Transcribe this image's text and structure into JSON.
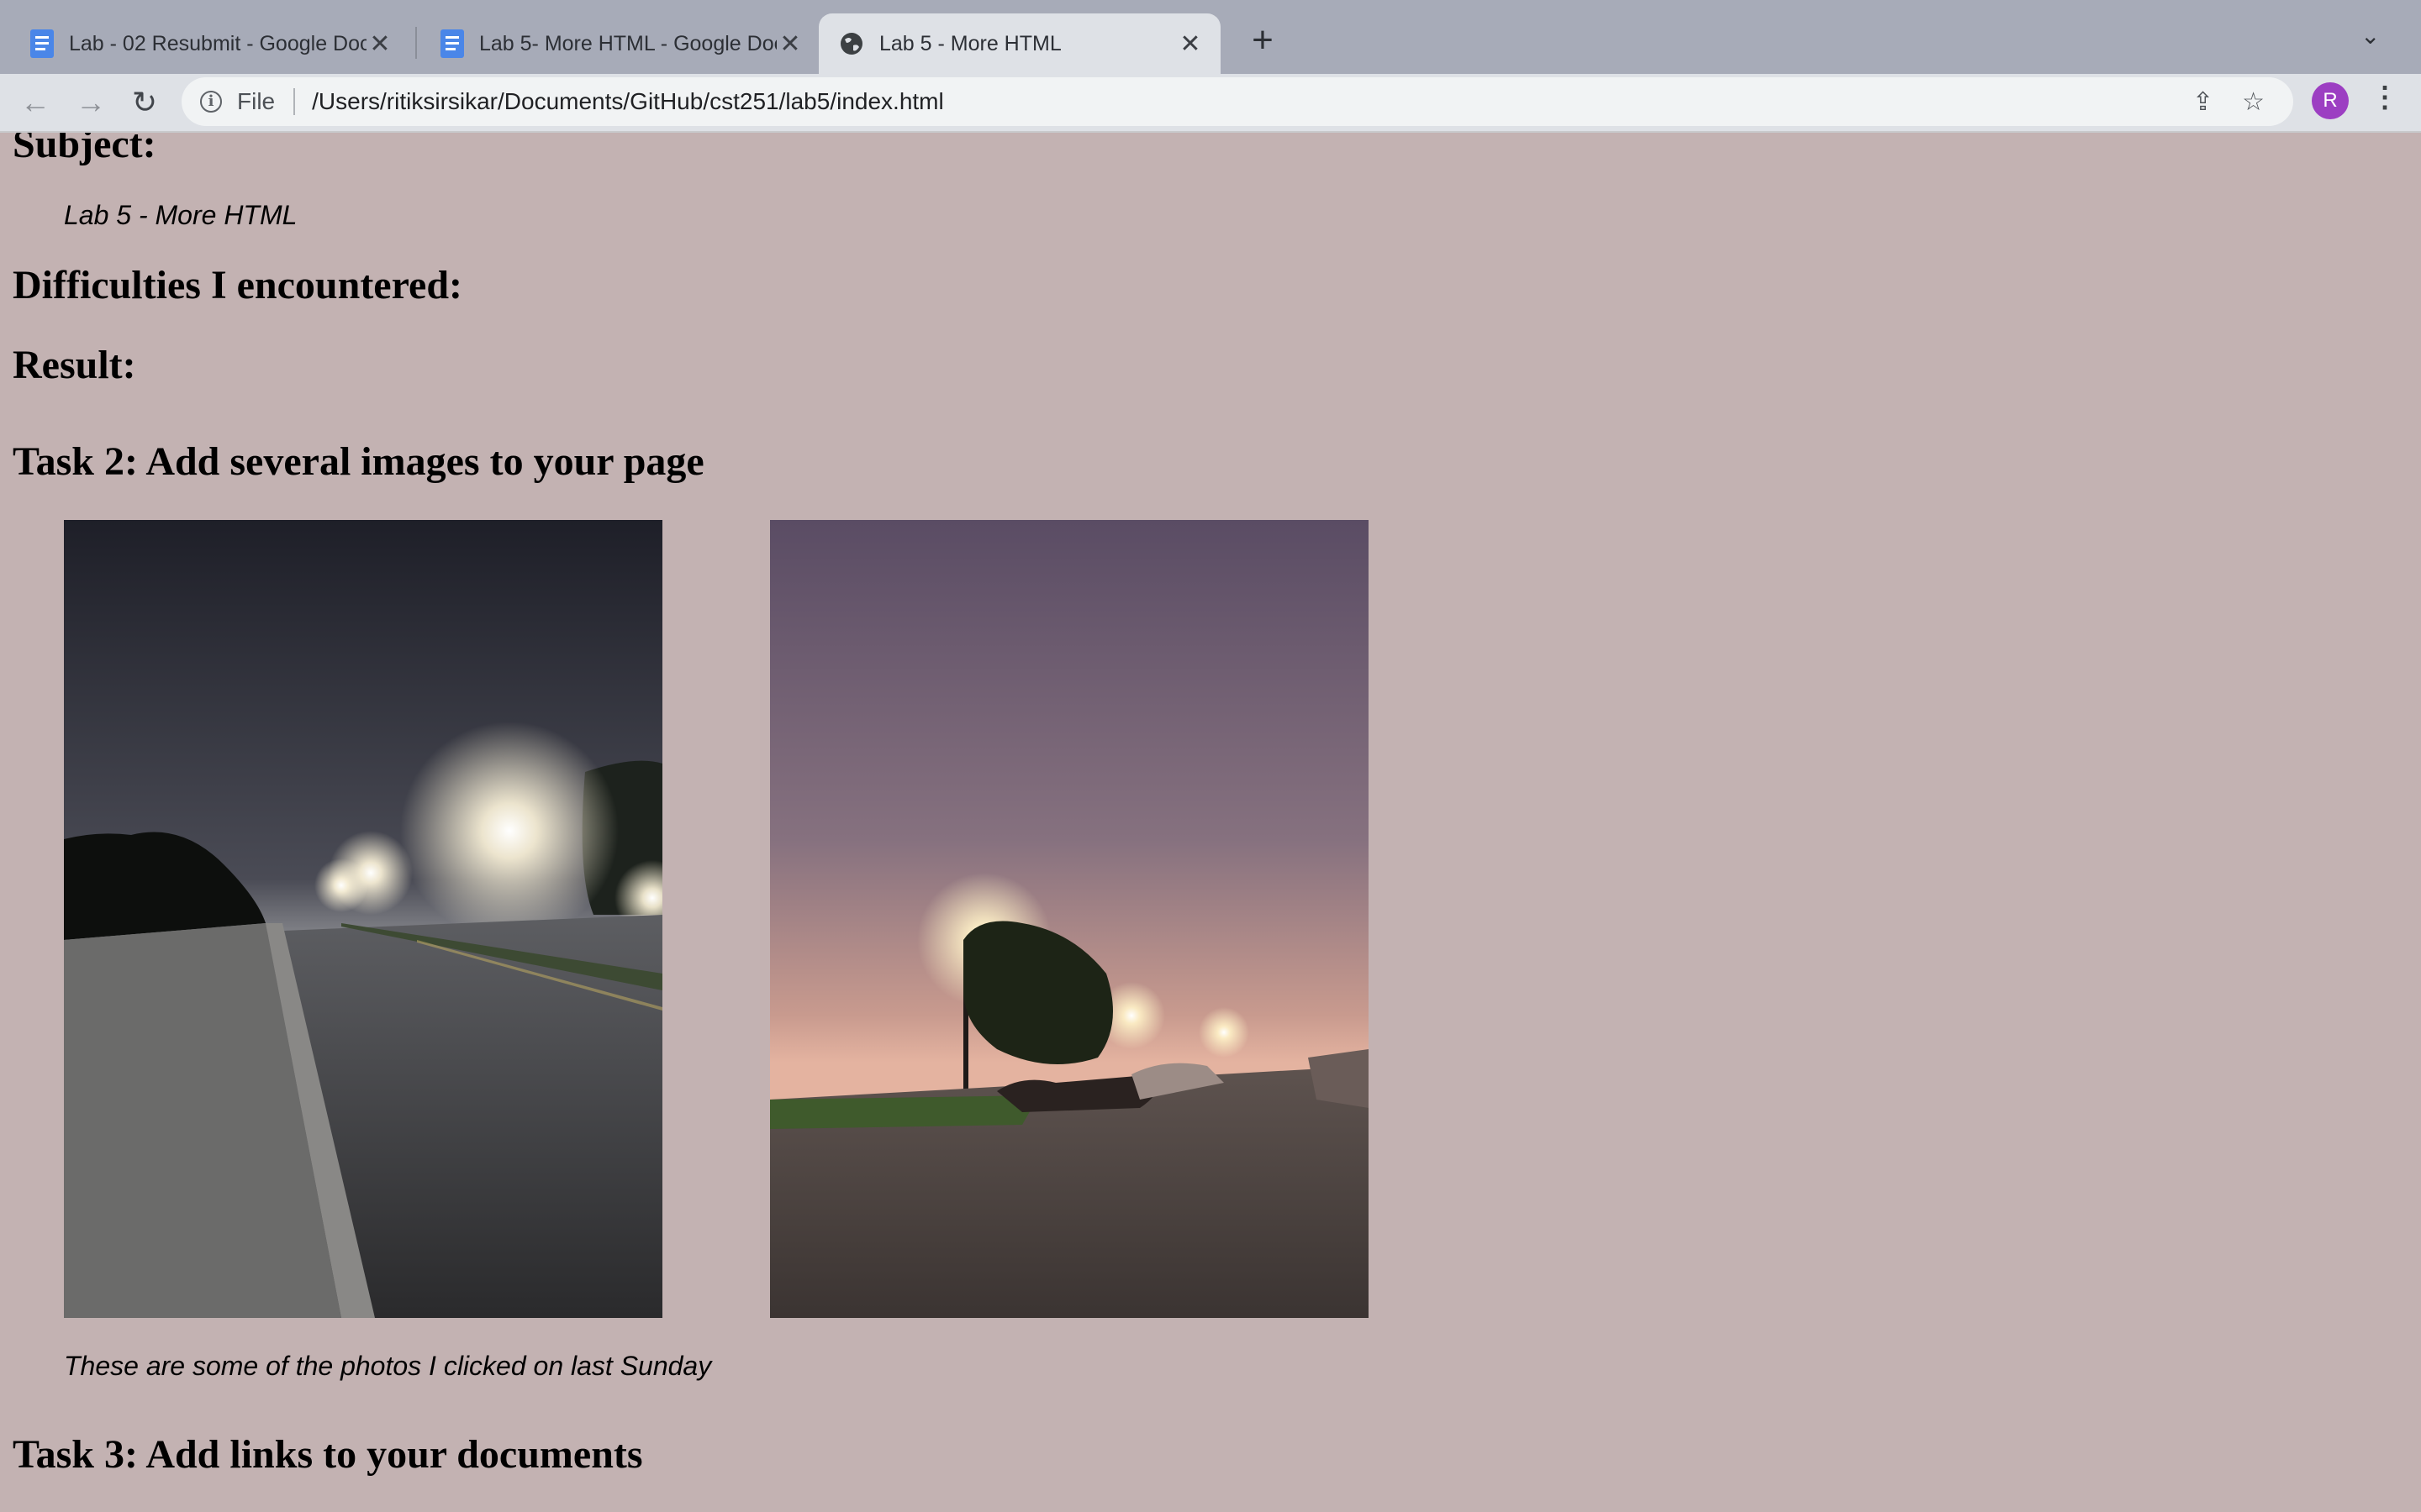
{
  "browser": {
    "tabs": [
      {
        "label": "Lab - 02 Resubmit - Google Docs",
        "icon": "google-docs-icon"
      },
      {
        "label": "Lab 5- More HTML - Google Docs",
        "icon": "google-docs-icon"
      },
      {
        "label": "Lab 5 - More HTML",
        "icon": "globe-icon",
        "active": true
      }
    ],
    "scheme_label": "File",
    "url": "/Users/ritiksirsikar/Documents/GitHub/cst251/lab5/index.html",
    "profile_initial": "R",
    "colors": {
      "tabstrip": "#a7abb8",
      "toolbar": "#dee1e6",
      "avatar": "#9c3ec2"
    }
  },
  "page": {
    "background": "#c3b2b2",
    "subject_heading": "Subject:",
    "subject_text": "Lab 5 - More HTML",
    "difficulties_heading": "Difficulties I encountered:",
    "result_heading": "Result:",
    "task2_heading": "Task 2: Add several images to your page",
    "photos": [
      {
        "subject": "foggy street at night with lit street lamps and sidewalk"
      },
      {
        "subject": "foggy parking lot at night with tree, lamp and parked cars"
      }
    ],
    "caption": "These are some of the photos I clicked on last Sunday",
    "task3_heading": "Task 3: Add links to your documents"
  }
}
